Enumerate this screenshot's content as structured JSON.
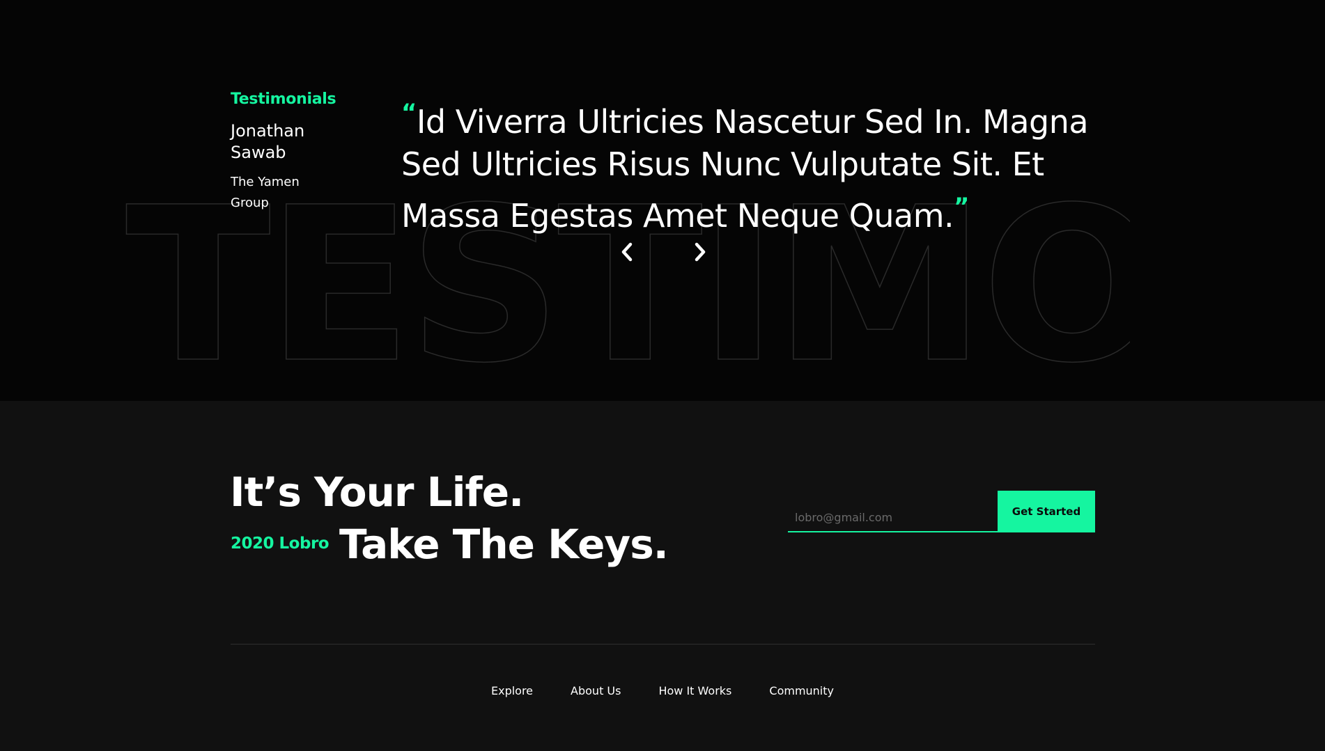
{
  "testimonials": {
    "section_label": "Testimonials",
    "background_word": "TESTIMONIALS",
    "author_name": "Jonathan Sawab",
    "author_company": "The Yamen Group",
    "open_quote": "“",
    "close_quote": "”",
    "quote_text": "Id Viverra Ultricies Nascetur Sed In. Magna Sed Ultricies Risus Nunc Vulputate Sit. Et Massa Egestas Amet Neque Quam.",
    "prev_icon": "chevron-left-icon",
    "next_icon": "chevron-right-icon"
  },
  "cta": {
    "headline_line1": "It’s Your Life.",
    "headline_line2": "Take The Keys.",
    "copyright": "2020 Lobro",
    "email_placeholder": "lobro@gmail.com",
    "button_label": "Get Started"
  },
  "footer": {
    "nav": [
      {
        "label": "Explore"
      },
      {
        "label": "About Us"
      },
      {
        "label": "How It Works"
      },
      {
        "label": "Community"
      }
    ]
  },
  "colors": {
    "accent": "#15f5a0",
    "top_background": "#050505",
    "bottom_background": "#111111",
    "text": "#ffffff"
  }
}
